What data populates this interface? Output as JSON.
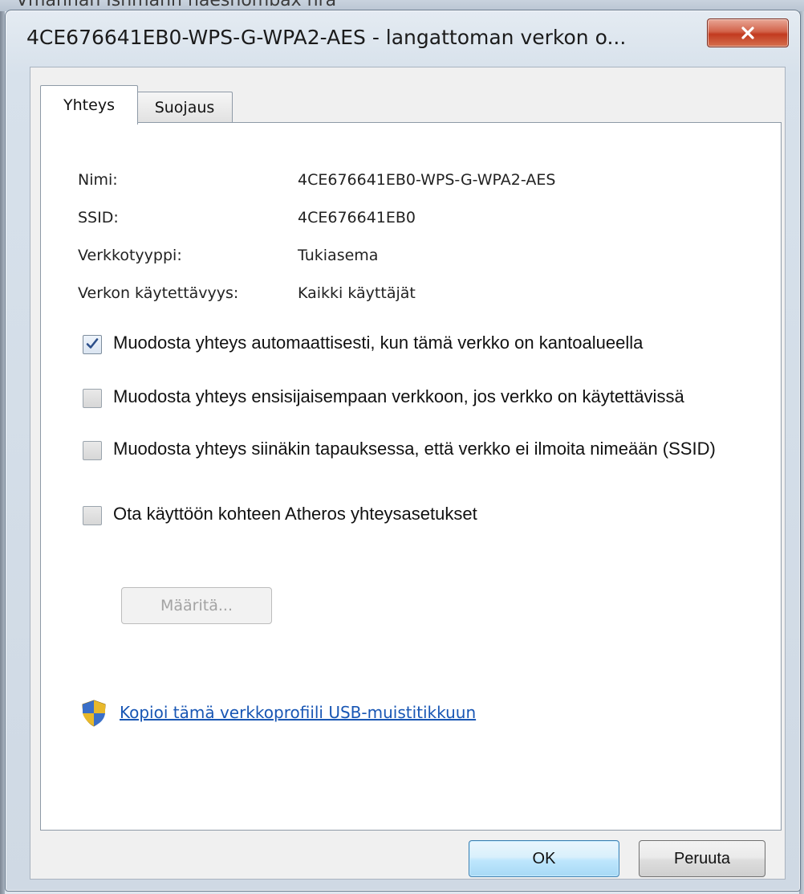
{
  "window": {
    "title": "4CE676641EB0-WPS-G-WPA2-AES - langattoman verkon o..."
  },
  "backdrop": {
    "partial_text": "Vmannan Isnmann haesnombax nra"
  },
  "tabs": [
    {
      "label": "Yhteys",
      "active": true
    },
    {
      "label": "Suojaus",
      "active": false
    }
  ],
  "info": [
    {
      "label": "Nimi:",
      "value": "4CE676641EB0-WPS-G-WPA2-AES"
    },
    {
      "label": "SSID:",
      "value": "4CE676641EB0"
    },
    {
      "label": "Verkkotyyppi:",
      "value": "Tukiasema"
    },
    {
      "label": "Verkon käytettävyys:",
      "value": "Kaikki käyttäjät"
    }
  ],
  "checkboxes": [
    {
      "label": "Muodosta yhteys automaattisesti, kun tämä verkko on kantoalueella",
      "checked": true
    },
    {
      "label": "Muodosta yhteys ensisijaisempaan verkkoon, jos verkko on käytettävissä",
      "checked": false
    },
    {
      "label": "Muodosta yhteys siinäkin tapauksessa, että verkko ei ilmoita nimeään (SSID)",
      "checked": false
    },
    {
      "label": "Ota käyttöön kohteen Atheros yhteysasetukset",
      "checked": false
    }
  ],
  "configure_button": {
    "label": "Määritä...",
    "enabled": false
  },
  "usb_link": {
    "label": "Kopioi tämä verkkoprofiili USB-muistitikkuun",
    "icon": "shield-icon"
  },
  "buttons": {
    "ok": "OK",
    "cancel": "Peruuta"
  },
  "colors": {
    "link": "#1856b4",
    "close_button": "#c23a1f",
    "ok_border": "#3c7fb1"
  }
}
